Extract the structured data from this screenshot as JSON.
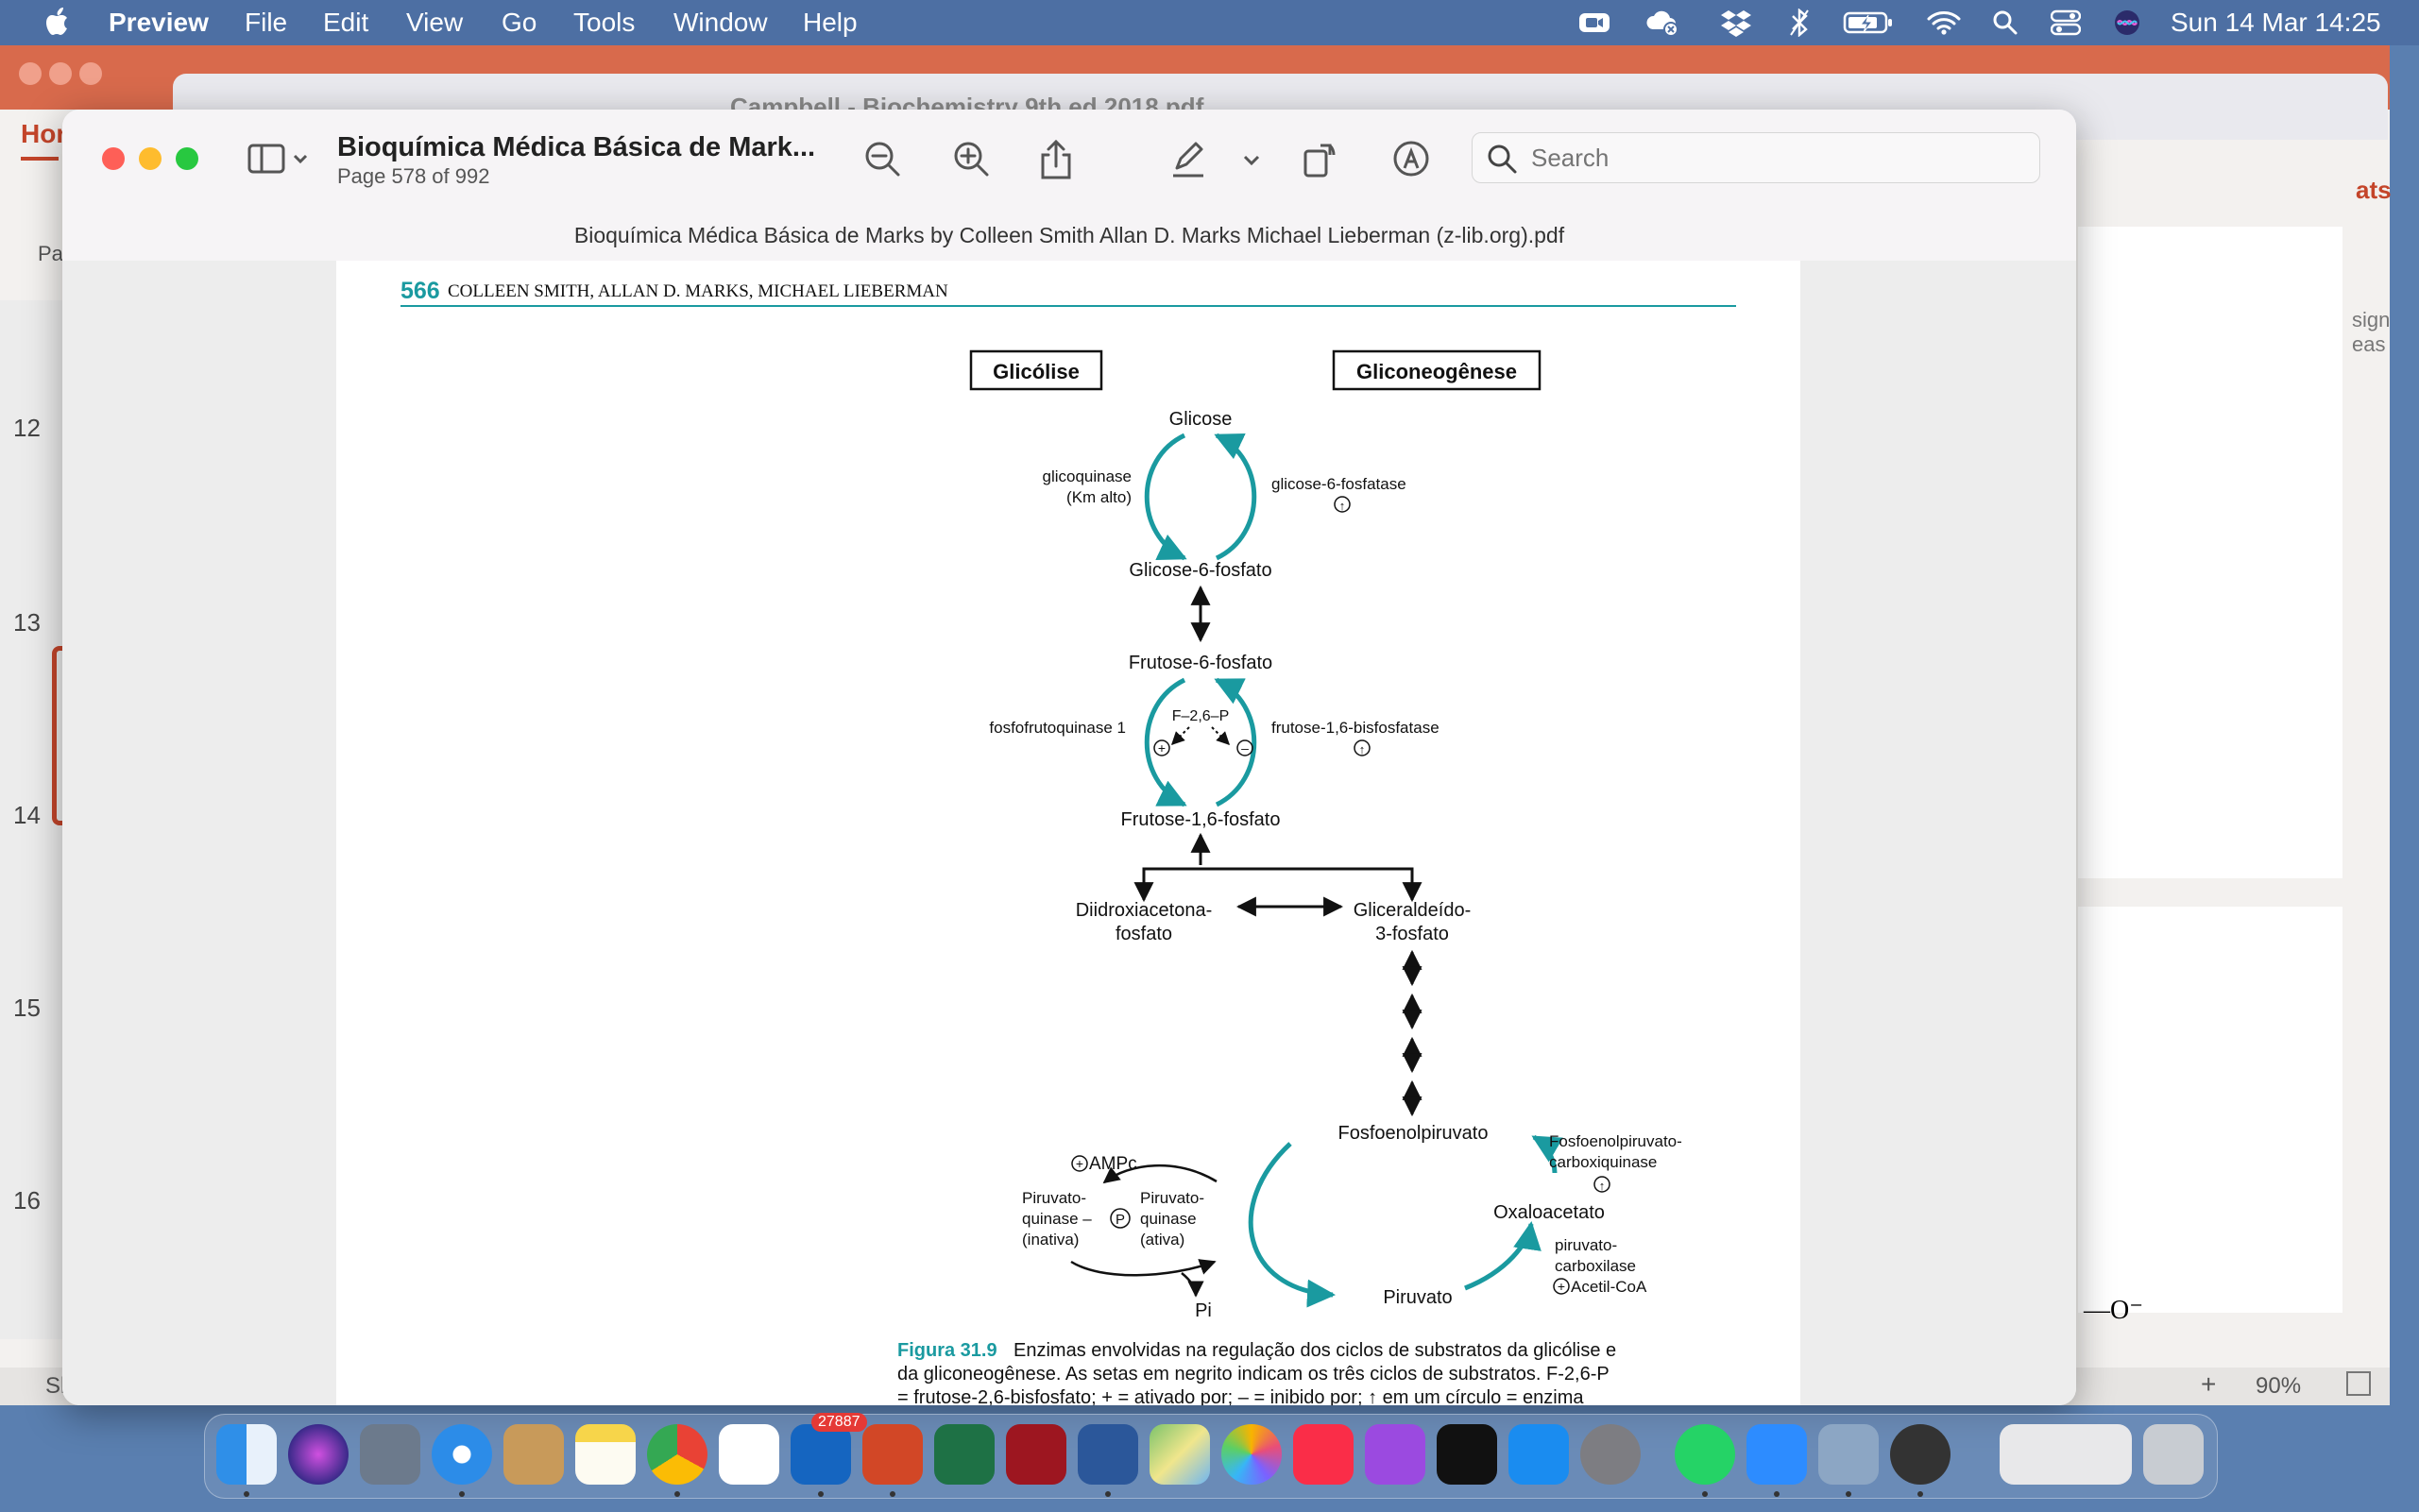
{
  "menubar": {
    "app_name": "Preview",
    "menus": [
      "File",
      "Edit",
      "View",
      "Go",
      "Tools",
      "Window",
      "Help"
    ],
    "clock": "Sun 14 Mar  14:25"
  },
  "background": {
    "powerpoint": {
      "tab_home": "Hor",
      "paste_label": "Pa",
      "design_label": "sign\neas",
      "tab_right": "ats",
      "slide_numbers": [
        "12",
        "13",
        "14",
        "15",
        "16"
      ],
      "zoom": "90%",
      "status_left": "Sl"
    },
    "campbell_title": "Campbell - Biochemistry 9th ed 2018.pdf",
    "stray_formula": "—O⁻"
  },
  "preview": {
    "title": "Bioquímica Médica Básica de Mark...",
    "page_info": "Page 578 of 992",
    "search_placeholder": "Search",
    "file_name": "Bioquímica Médica Básica de Marks by Colleen Smith Allan D. Marks Michael Lieberman (z-lib.org).pdf"
  },
  "pdf_page": {
    "page_number": "566",
    "running_head": "COLLEEN SMITH, ALLAN D. MARKS, MICHAEL LIEBERMAN",
    "diagram": {
      "box_left": "Glicólise",
      "box_right": "Gliconeogênese",
      "glicose": "Glicose",
      "glicoquinase": "glicoquinase",
      "km_alto": "(Km alto)",
      "g6pase": "glicose-6-fosfatase",
      "g6p": "Glicose-6-fosfato",
      "f6p": "Frutose-6-fosfato",
      "pfk": "fosfofrutoquinase 1",
      "f26p": "F–2,6–P",
      "fbpase": "frutose-1,6-bisfosfatase",
      "f16p": "Frutose-1,6-fosfato",
      "dhap_1": "Diidroxiacetona-",
      "dhap_2": "fosfato",
      "g3p_1": "Gliceraldeído-",
      "g3p_2": "3-fosfato",
      "pep": "Fosfoenolpiruvato",
      "pepck_1": "Fosfoenolpiruvato-",
      "pepck_2": "carboxiquinase",
      "oaa": "Oxaloacetato",
      "pc_1": "piruvato-",
      "pc_2": "carboxilase",
      "acetil": "Acetil-CoA",
      "piruvato": "Piruvato",
      "ampc": "AMPc",
      "pk_in_1": "Piruvato-",
      "pk_in_2": "quinase –",
      "pk_in_3": "(inativa)",
      "pk_act_1": "Piruvato-",
      "pk_act_2": "quinase",
      "pk_act_3": "(ativa)",
      "pi": "Pi"
    },
    "caption": {
      "label": "Figura 31.9",
      "line1": "Enzimas envolvidas na regulação dos ciclos de substratos da glicólise e",
      "line2": "da gliconeogênese. As setas em negrito indicam os três ciclos de substratos. F-2,6-P",
      "line3": "= frutose-2,6-bisfosfato; + = ativado por; – = inibido por; ↑ em um círculo = enzima"
    }
  },
  "dock": {
    "outlook_badge": "27887",
    "apps": [
      "Finder",
      "Siri",
      "Launchpad",
      "Safari",
      "Contacts",
      "Notes",
      "Chrome",
      "Reminders",
      "Outlook",
      "PowerPoint",
      "Excel",
      "Mendeley",
      "Word",
      "Maps",
      "Photos",
      "Music",
      "Podcasts",
      "Apple TV",
      "App Store",
      "System Preferences",
      "WhatsApp",
      "Zoom",
      "Preview",
      "Vectorworks",
      "Downloads",
      "Trash"
    ]
  }
}
